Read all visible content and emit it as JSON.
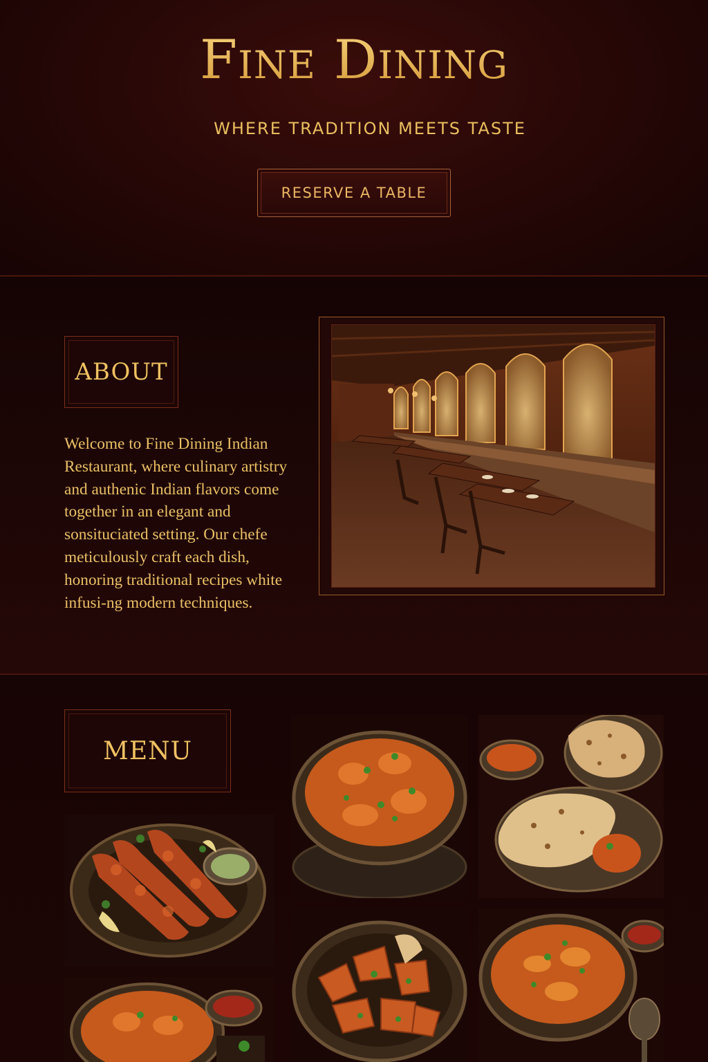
{
  "hero": {
    "title": "Fine Dining",
    "subtitle": "WHERE TRADITION MEETS TASTE",
    "reserve_label": "RESERVE A TABLE"
  },
  "about": {
    "heading": "ABOUT",
    "body": "Welcome to Fine Dining Indian Restaurant, where culinary artistry and authenic Indian flavors come together in an elegant and sonsituciated setting. Our chefe meticulously craft each dish, honoring traditional recipes white infusi-ng modern techniques.",
    "image_icon": "restaurant-interior-image"
  },
  "menu": {
    "heading": "MENU",
    "dishes": [
      {
        "icon": "kebab-skewers-image"
      },
      {
        "icon": "curry-bowl-image"
      },
      {
        "icon": "naan-and-curry-image"
      },
      {
        "icon": "curry-bowl-image"
      },
      {
        "icon": "pakora-bowl-image"
      },
      {
        "icon": "curry-bowl-image"
      }
    ]
  },
  "colors": {
    "background": "#1a0605",
    "accent_gold": "#e9bd62",
    "border_maroon": "#7a2e1c"
  }
}
